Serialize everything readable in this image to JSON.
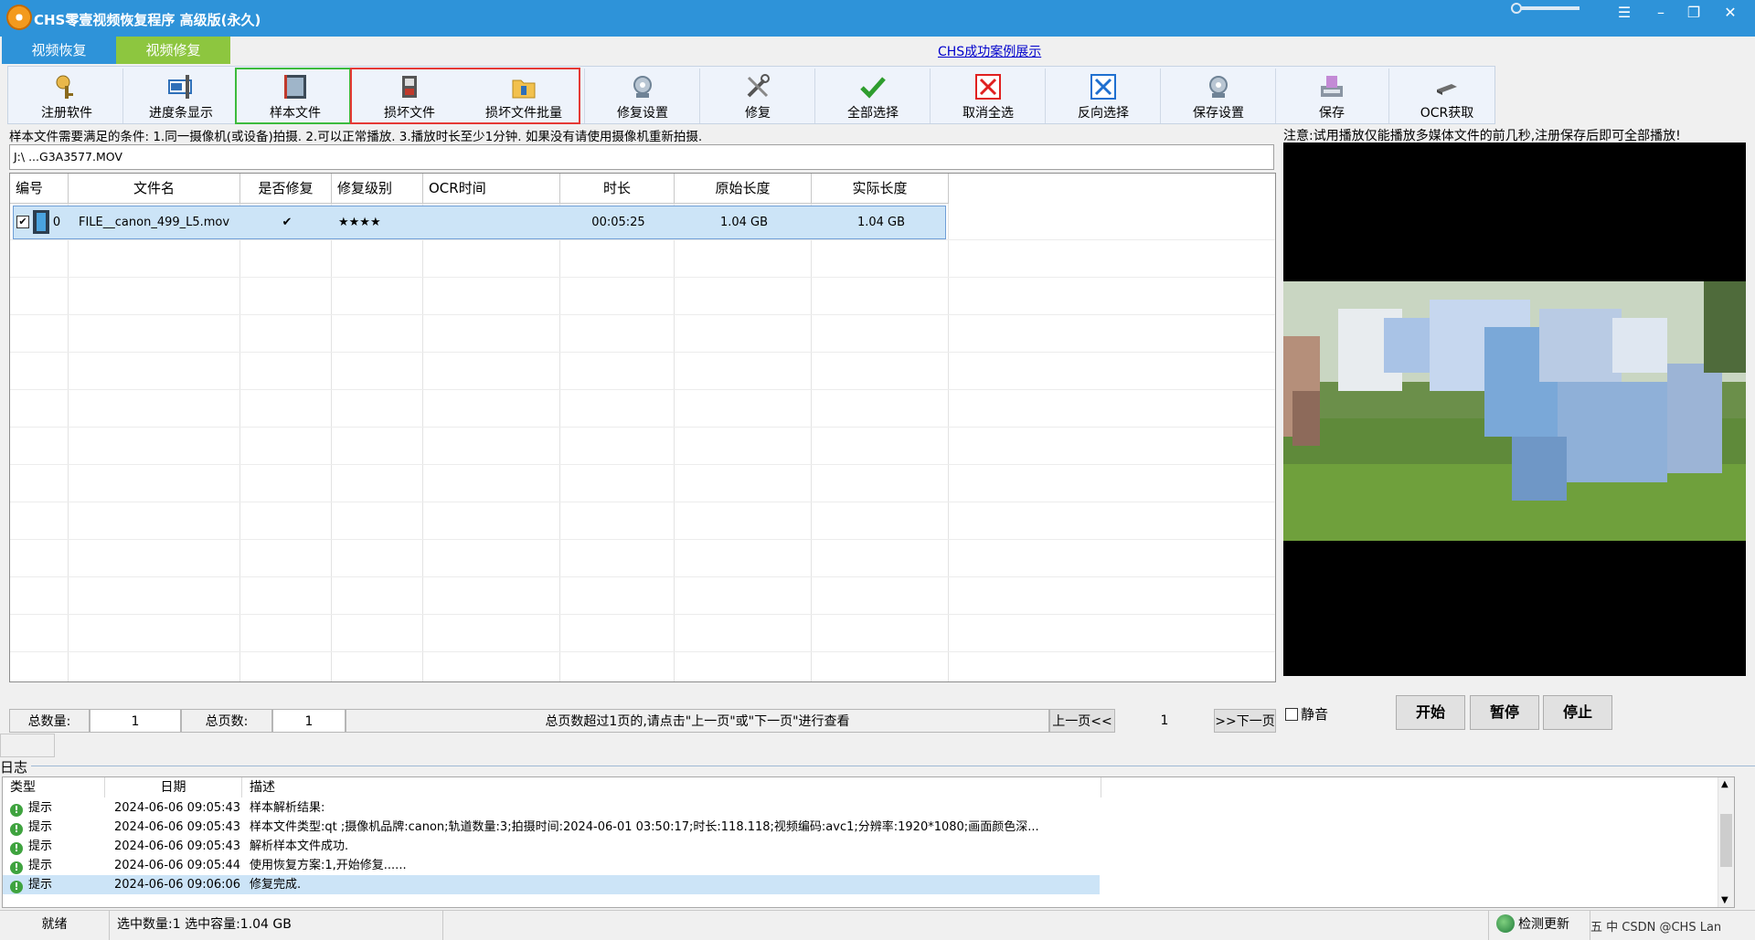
{
  "app": {
    "title": "CHS零壹视频恢复程序 高级版(永久)"
  },
  "tabs": [
    {
      "label": "视频恢复"
    },
    {
      "label": "视频修复"
    }
  ],
  "case_link": "CHS成功案例展示",
  "toolbar": {
    "items": [
      {
        "label": "注册软件",
        "icon": "register-icon"
      },
      {
        "label": "进度条显示",
        "icon": "progress-icon"
      },
      {
        "label": "样本文件",
        "icon": "sample-file-icon"
      },
      {
        "label": "损坏文件",
        "icon": "damaged-file-icon"
      },
      {
        "label": "损坏文件批量",
        "icon": "batch-folder-icon"
      },
      {
        "label": "修复设置",
        "icon": "repair-settings-icon"
      },
      {
        "label": "修复",
        "icon": "repair-tools-icon"
      },
      {
        "label": "全部选择",
        "icon": "check-icon"
      },
      {
        "label": "取消全选",
        "icon": "cancel-icon"
      },
      {
        "label": "反向选择",
        "icon": "invert-icon"
      },
      {
        "label": "保存设置",
        "icon": "save-settings-icon"
      },
      {
        "label": "保存",
        "icon": "save-icon"
      },
      {
        "label": "OCR获取",
        "icon": "ocr-icon"
      }
    ]
  },
  "hint": "样本文件需要满足的条件: 1.同一摄像机(或设备)拍摄. 2.可以正常播放. 3.播放时长至少1分钟. 如果没有请使用摄像机重新拍摄.",
  "sample_path": "J:\\  ...G3A3577.MOV",
  "table": {
    "headers": [
      "编号",
      "文件名",
      "是否修复",
      "修复级别",
      "OCR时间",
      "时长",
      "原始长度",
      "实际长度"
    ],
    "rows": [
      {
        "num": "0",
        "name": "FILE__canon_499_L5.mov",
        "repaired": "✔",
        "level": "★★★★",
        "ocr": "",
        "duration": "00:05:25",
        "orig_size": "1.04 GB",
        "actual_size": "1.04 GB"
      }
    ]
  },
  "pager": {
    "total_label": "总数量:",
    "total": "1",
    "pages_label": "总页数:",
    "pages": "1",
    "note": "总页数超过1页的,请点击\"上一页\"或\"下一页\"进行查看",
    "prev": "上一页<<",
    "page": "1",
    "next": ">>下一页"
  },
  "preview": {
    "note": "注意:试用播放仅能播放多媒体文件的前几秒,注册保存后即可全部播放!",
    "mute": "静音",
    "start": "开始",
    "pause": "暂停",
    "stop": "停止"
  },
  "log": {
    "title": "日志",
    "headers": [
      "类型",
      "日期",
      "描述"
    ],
    "rows": [
      {
        "type": "提示",
        "date": "2024-06-06 09:05:43",
        "msg": "样本解析结果:"
      },
      {
        "type": "提示",
        "date": "2024-06-06 09:05:43",
        "msg": "样本文件类型:qt ;摄像机品牌:canon;轨道数量:3;拍摄时间:2024-06-01 03:50:17;时长:118.118;视频编码:avc1;分辨率:1920*1080;画面颜色深..."
      },
      {
        "type": "提示",
        "date": "2024-06-06 09:05:43",
        "msg": "解析样本文件成功."
      },
      {
        "type": "提示",
        "date": "2024-06-06 09:05:44",
        "msg": "使用恢复方案:1,开始修复......"
      },
      {
        "type": "提示",
        "date": "2024-06-06 09:06:06",
        "msg": "修复完成."
      }
    ]
  },
  "status": {
    "ready": "就绪",
    "selection": "选中数量:1 选中容量:1.04 GB",
    "update": "检测更新",
    "tray": "五 中 CSDN @CHS Lan"
  },
  "colors": {
    "titlebar": "#2e93d9",
    "repair_tab": "#8dc63f",
    "selection": "#cce4f7"
  }
}
